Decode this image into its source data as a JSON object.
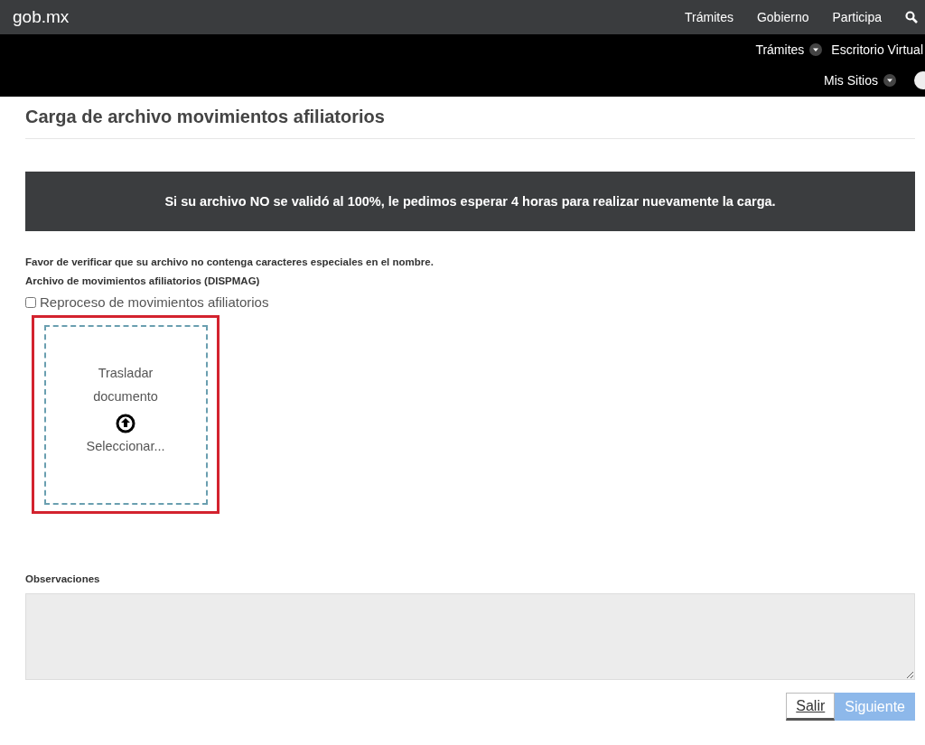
{
  "header": {
    "logo": "gob.mx",
    "nav": [
      {
        "label": "Trámites"
      },
      {
        "label": "Gobierno"
      },
      {
        "label": "Participa"
      }
    ]
  },
  "subnav": {
    "row1": [
      {
        "label": "Trámites",
        "dropdown": true
      },
      {
        "label": "Escritorio Virtual",
        "dropdown": false
      }
    ],
    "row2": [
      {
        "label": "Mis Sitios",
        "dropdown": true
      }
    ]
  },
  "page": {
    "title": "Carga de archivo movimientos afiliatorios",
    "banner": "Si su archivo NO se validó al 100%, le pedimos esperar 4 horas para realizar nuevamente la carga.",
    "notice": "Favor de verificar que su archivo no contenga caracteres especiales en el nombre.",
    "file_label": "Archivo de movimientos afiliatorios (DISPMAG)",
    "reprocess": {
      "label": "Reproceso de movimientos afiliatorios",
      "checked": false
    },
    "dropzone": {
      "title_lines": [
        "Trasladar",
        "documento"
      ],
      "select": "Seleccionar...",
      "highlighted": true
    },
    "observations": {
      "label": "Observaciones"
    },
    "buttons": [
      {
        "label": "Salir",
        "kind": "secondary",
        "disabled": false
      },
      {
        "label": "Siguiente",
        "kind": "primary",
        "disabled": true
      }
    ]
  }
}
